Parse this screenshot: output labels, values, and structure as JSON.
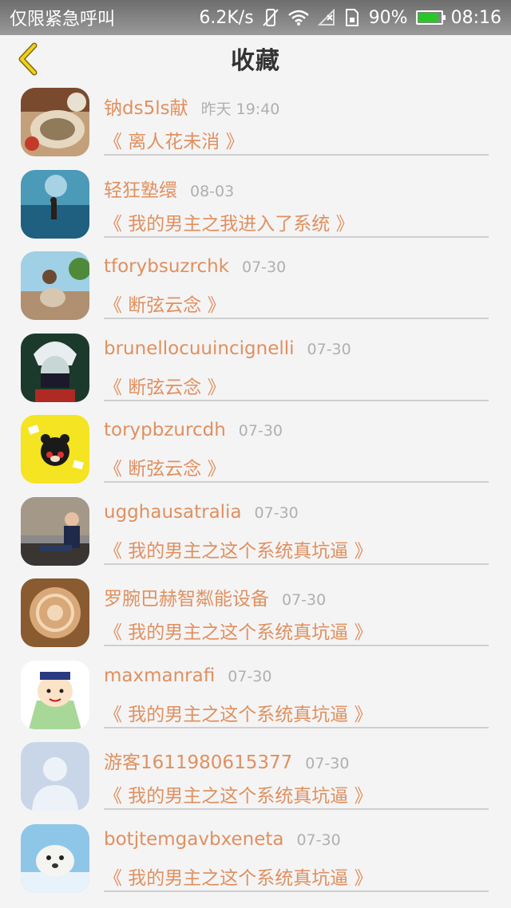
{
  "status_bar": {
    "carrier": "仅限紧急呼叫",
    "speed": "6.2K/s",
    "battery_percent": "90%",
    "battery_level": 0.9,
    "time": "08:16"
  },
  "header": {
    "title": "收藏"
  },
  "items": [
    {
      "name": "钠ds5ls献",
      "time": "昨天 19:40",
      "book": "《 离人花未消 》"
    },
    {
      "name": "轻狂塾缳",
      "time": "08-03",
      "book": "《 我的男主之我进入了系统 》"
    },
    {
      "name": "tforybsuzrchk",
      "time": "07-30",
      "book": "《 断弦云念 》"
    },
    {
      "name": "brunellocuuincignelli",
      "time": "07-30",
      "book": "《 断弦云念 》"
    },
    {
      "name": "torypbzurcdh",
      "time": "07-30",
      "book": "《 断弦云念 》"
    },
    {
      "name": "ugghausatralia",
      "time": "07-30",
      "book": "《 我的男主之这个系统真坑逼 》"
    },
    {
      "name": "罗腕巴赫智粼能设备",
      "time": "07-30",
      "book": "《 我的男主之这个系统真坑逼 》"
    },
    {
      "name": "maxmanrafi",
      "time": "07-30",
      "book": "《 我的男主之这个系统真坑逼 》"
    },
    {
      "name": "游客1611980615377",
      "time": "07-30",
      "book": "《 我的男主之这个系统真坑逼 》"
    },
    {
      "name": "botjtemgavbxeneta",
      "time": "07-30",
      "book": "《 我的男主之这个系统真坑逼 》"
    }
  ]
}
